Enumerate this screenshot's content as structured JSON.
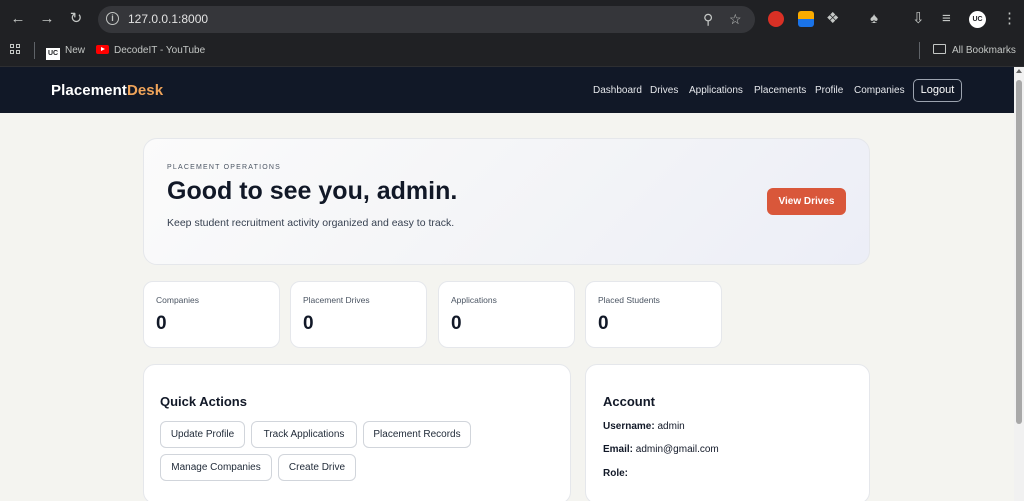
{
  "browser": {
    "url": "127.0.0.1:8000",
    "bookmarks": [
      {
        "label": "New",
        "icon": "uc-logo-icon"
      },
      {
        "label": "DecodeIT - YouTube",
        "icon": "youtube-icon"
      }
    ],
    "all_bookmarks_label": "All Bookmarks",
    "profile_initials": "UC"
  },
  "app": {
    "brand_main": "Placement",
    "brand_accent": "Desk",
    "brand_accent_color": "#f0a45a",
    "nav": [
      "Dashboard",
      "Drives",
      "Applications",
      "Placements",
      "Profile",
      "Companies"
    ],
    "logout_label": "Logout"
  },
  "hero": {
    "eyebrow": "PLACEMENT OPERATIONS",
    "title": "Good to see you, admin.",
    "subtitle": "Keep student recruitment activity organized and easy to track.",
    "cta_label": "View Drives",
    "cta_color": "#d9573a"
  },
  "stats": [
    {
      "label": "Companies",
      "value": "0"
    },
    {
      "label": "Placement Drives",
      "value": "0"
    },
    {
      "label": "Applications",
      "value": "0"
    },
    {
      "label": "Placed Students",
      "value": "0"
    }
  ],
  "quick_actions": {
    "title": "Quick Actions",
    "buttons": [
      "Update Profile",
      "Track Applications",
      "Placement Records",
      "Manage Companies",
      "Create Drive"
    ]
  },
  "account": {
    "title": "Account",
    "username_label": "Username:",
    "username": "admin",
    "email_label": "Email:",
    "email": "admin@gmail.com",
    "role_label": "Role:",
    "role": ""
  }
}
